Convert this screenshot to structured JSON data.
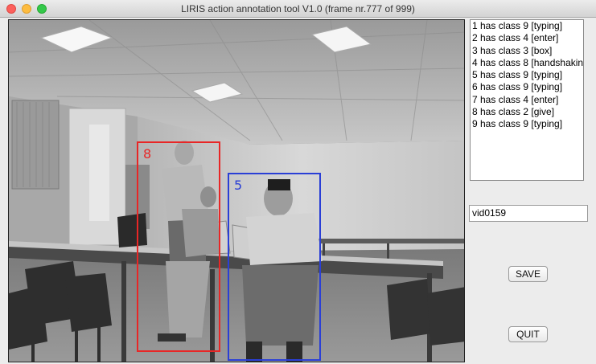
{
  "window": {
    "title": "LIRIS action annotation tool V1.0 (frame nr.777 of 999)"
  },
  "annotations": [
    {
      "label": "8",
      "color": "#e82626"
    },
    {
      "label": "5",
      "color": "#2a3fd6"
    }
  ],
  "action_list": [
    "1 has class 9 [typing]",
    "2 has class 4 [enter]",
    "3 has class 3 [box]",
    "4 has class 8 [handshakin",
    "5 has class 9 [typing]",
    "6 has class 9 [typing]",
    "7 has class 4 [enter]",
    "8 has class 2 [give]",
    "9 has class 9 [typing]"
  ],
  "video_field": {
    "value": "vid0159"
  },
  "buttons": {
    "save": "SAVE",
    "quit": "QUIT"
  }
}
